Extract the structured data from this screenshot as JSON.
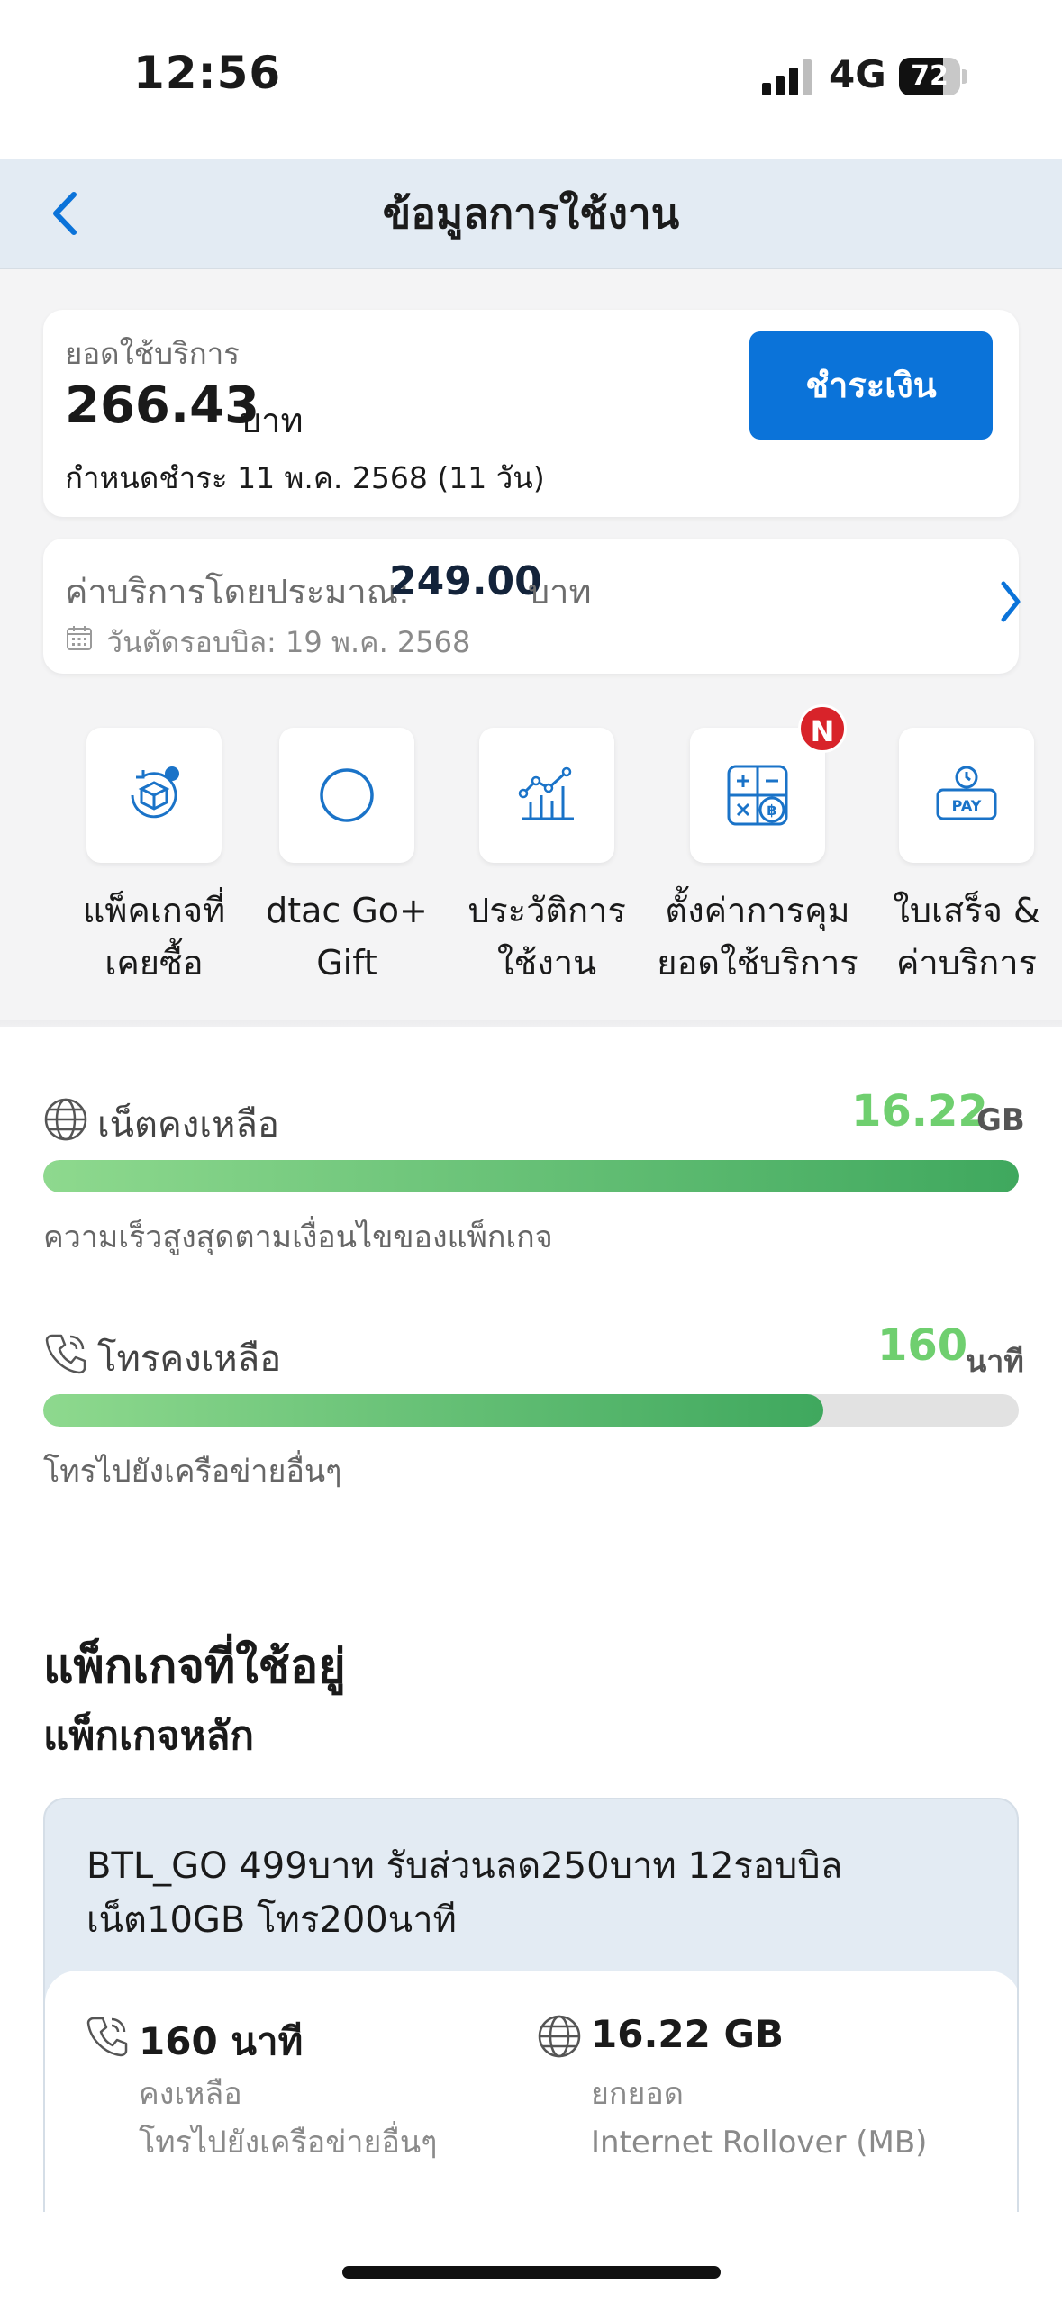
{
  "status_bar": {
    "time": "12:56",
    "network": "4G",
    "battery": "72",
    "battery_level": 0.72
  },
  "header": {
    "title": "ข้อมูลการใช้งาน",
    "back_icon": "chevron-left-icon"
  },
  "bill": {
    "label": "ยอดใช้บริการ",
    "amount": "266.43",
    "unit": "บาท",
    "due": "กำหนดชำระ 11 พ.ค. 2568 (11 วัน)",
    "pay_button": "ชำระเงิน"
  },
  "estimate": {
    "label": "ค่าบริการโดยประมาณ:",
    "amount": "249.00",
    "unit": "บาท",
    "cycle": "วันตัดรอบบิล: 19 พ.ค. 2568"
  },
  "quick_actions": [
    {
      "label": "แพ็คเกจที่\nเคยซื้อ",
      "icon": "package-history-icon"
    },
    {
      "label": "dtac Go+\nGift",
      "icon": "circle-icon"
    },
    {
      "label": "ประวัติการ\nใช้งาน",
      "icon": "usage-chart-icon"
    },
    {
      "label": "ตั้งค่าการคุม\nยอดใช้บริการ",
      "icon": "calculator-icon",
      "badge": "N"
    },
    {
      "label": "ใบเสร็จ &\nค่าบริการ",
      "icon": "pay-icon"
    }
  ],
  "usage": {
    "internet": {
      "label": "เน็ตคงเหลือ",
      "value": "16.22",
      "unit": "GB",
      "note": "ความเร็วสูงสุดตามเงื่อนไขของแพ็กเกจ",
      "level": 1.0
    },
    "voice": {
      "label": "โทรคงเหลือ",
      "value": "160",
      "unit": "นาที",
      "note": "โทรไปยังเครือข่ายอื่นๆ",
      "level": 0.8
    }
  },
  "packages": {
    "title": "แพ็กเกจที่ใช้อยู่",
    "subtitle": "แพ็กเกจหลัก",
    "main": {
      "name": "BTL_GO 499บาท รับส่วนลด250บาท 12รอบบิล เน็ต10GB โทร200นาที",
      "voice_value": "160 นาที",
      "voice_sub1": "คงเหลือ",
      "voice_sub2": "โทรไปยังเครือข่ายอื่นๆ",
      "data_value": "16.22 GB",
      "data_sub1": "ยกยอด",
      "data_sub2": "Internet Rollover (MB)"
    }
  },
  "colors": {
    "accent": "#0b73d9",
    "green": "#6fcf6f",
    "badge": "#d8232a"
  }
}
